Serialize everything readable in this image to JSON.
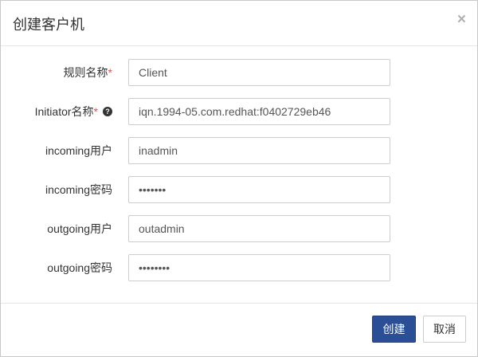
{
  "dialog": {
    "title": "创建客户机",
    "close_glyph": "×"
  },
  "form": {
    "required_mark": "*",
    "help_icon": "question-circle-icon",
    "fields": [
      {
        "label": "规则名称",
        "required": true,
        "value": "Client",
        "type": "text"
      },
      {
        "label": "Initiator名称",
        "required": true,
        "help": true,
        "value": "iqn.1994-05.com.redhat:f0402729eb46",
        "type": "text"
      },
      {
        "label": "incoming用户",
        "required": false,
        "value": "inadmin",
        "type": "text"
      },
      {
        "label": "incoming密码",
        "required": false,
        "value": "1234567",
        "type": "password"
      },
      {
        "label": "outgoing用户",
        "required": false,
        "value": "outadmin",
        "type": "text"
      },
      {
        "label": "outgoing密码",
        "required": false,
        "value": "12345678",
        "type": "password"
      }
    ]
  },
  "footer": {
    "create_label": "创建",
    "cancel_label": "取消"
  },
  "colors": {
    "primary": "#2a4f96",
    "required": "#d9534f"
  }
}
